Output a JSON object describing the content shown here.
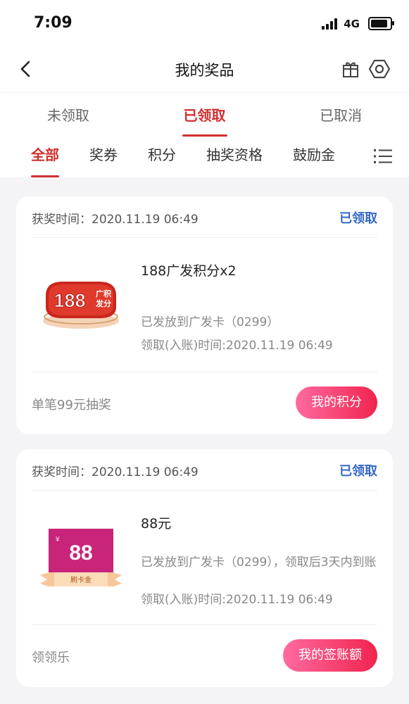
{
  "status_bar": {
    "time": "7:09",
    "network": "4G"
  },
  "header": {
    "title": "我的奖品"
  },
  "main_tabs": [
    {
      "label": "未领取"
    },
    {
      "label": "已领取"
    },
    {
      "label": "已取消"
    }
  ],
  "sub_tabs": [
    {
      "label": "全部"
    },
    {
      "label": "奖券"
    },
    {
      "label": "积分"
    },
    {
      "label": "抽奖资格"
    },
    {
      "label": "鼓励金"
    }
  ],
  "cards": [
    {
      "time": "获奖时间：2020.11.19 06:49",
      "status": "已领取",
      "prize_name": "188广发积分x2",
      "sent_text": "已发放到广发卡（0299）",
      "received_time": "领取(入账)时间:2020.11.19 06:49",
      "source": "单笔99元抽奖",
      "button": "我的积分",
      "image": {
        "number": "188",
        "tag_top": "广积",
        "tag_bottom": "发分"
      }
    },
    {
      "time": "获奖时间：2020.11.19 06:49",
      "status": "已领取",
      "prize_name": "88元",
      "sent_text": "已发放到广发卡（0299），领取后3天内到账",
      "received_time": "领取(入账)时间:2020.11.19 06:49",
      "source": "领领乐",
      "button": "我的签账额",
      "image": {
        "number": "88",
        "currency": "¥",
        "ribbon": "刷卡金"
      }
    }
  ]
}
